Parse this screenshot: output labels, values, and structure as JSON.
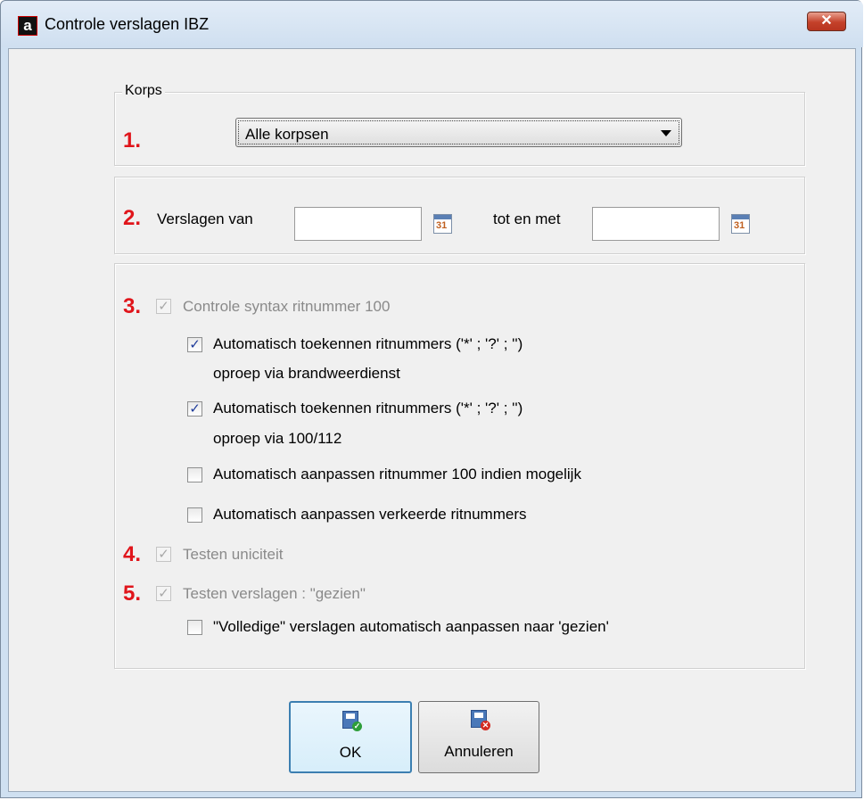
{
  "window": {
    "title": "Controle verslagen IBZ",
    "close_glyph": "✕",
    "app_icon_glyph": "a"
  },
  "korps": {
    "legend": "Korps",
    "number": "1.",
    "selected": "Alle korpsen"
  },
  "dates": {
    "number": "2.",
    "from_label": "Verslagen van",
    "from_value": "",
    "to_label": "tot en met",
    "to_value": "",
    "calendar_glyph": "31"
  },
  "controls": {
    "n3": "3.",
    "syntax_check": {
      "label": "Controle syntax ritnummer 100",
      "checked": true,
      "enabled": false
    },
    "auto_brandweer": {
      "label": "Automatisch toekennen ritnummers ('*' ; '?' ; '')",
      "label2": "oproep via brandweerdienst",
      "checked": true
    },
    "auto_100112": {
      "label": "Automatisch toekennen ritnummers ('*' ; '?' ; '')",
      "label2": "oproep via 100/112",
      "checked": true
    },
    "auto_adjust_100": {
      "label": "Automatisch aanpassen ritnummer 100 indien mogelijk",
      "checked": false
    },
    "auto_adjust_wrong": {
      "label": "Automatisch aanpassen verkeerde ritnummers",
      "checked": false
    },
    "n4": "4.",
    "uniqueness": {
      "label": "Testen uniciteit",
      "checked": true,
      "enabled": false
    },
    "n5": "5.",
    "test_seen": {
      "label": "Testen verslagen : \"gezien\"",
      "checked": true,
      "enabled": false
    },
    "complete_seen": {
      "label": "\"Volledige\" verslagen automatisch aanpassen naar 'gezien'",
      "checked": false
    },
    "check_glyph": "✓"
  },
  "buttons": {
    "ok": "OK",
    "cancel": "Annuleren"
  },
  "colors": {
    "number_red": "#e0151b",
    "check_blue": "#1e3b9a"
  }
}
